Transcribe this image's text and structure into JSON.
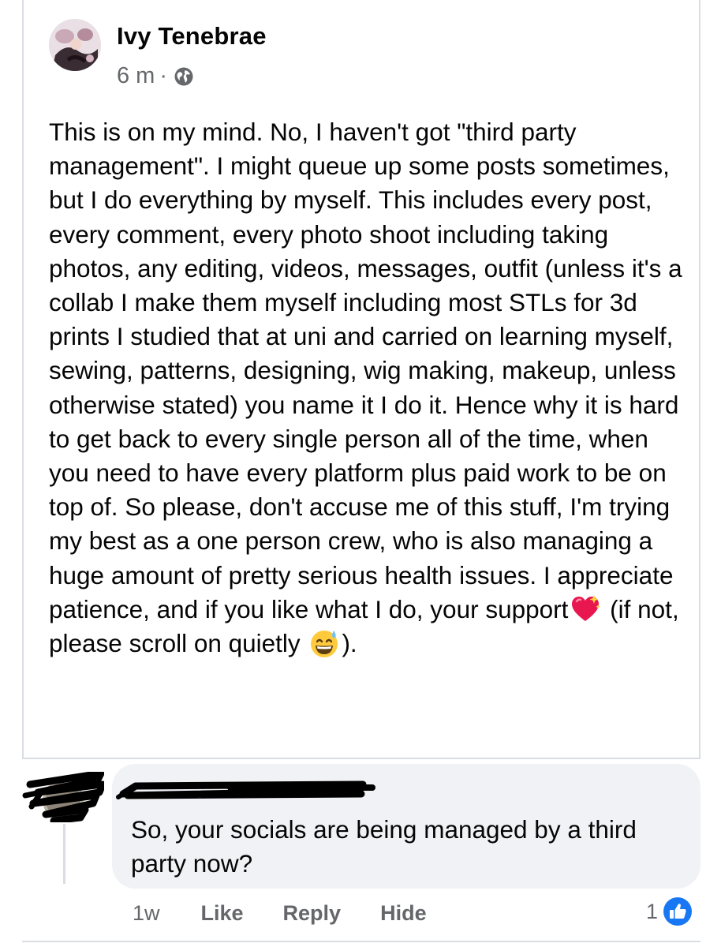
{
  "post": {
    "author": "Ivy Tenebrae",
    "time": "6 m",
    "separator": "·",
    "privacy_icon": "globe-icon",
    "body_main": "This is on my mind. No, I haven't got \"third party management\". I might queue up some posts sometimes, but I do everything by myself. This includes every post, every comment, every photo shoot including taking photos, any editing, videos, messages, outfit (unless it's a collab I make them myself including most STLs for 3d prints I studied that at uni and carried on learning myself, sewing, patterns, designing, wig making, makeup, unless otherwise stated) you name it I do it. Hence why it is hard to get back to every single person all of the time, when you need to have every platform plus paid work to be on top of. So please, don't accuse me of this stuff, I'm trying my best as a one person crew, who is also managing a huge amount of pretty serious health issues. I appreciate patience, and if you like what I do, your support",
    "body_mid": " (if not, please scroll on quietly ",
    "body_end": ").",
    "emoji_1": "sparkling-heart-emoji",
    "emoji_2": "grinning-sweat-emoji"
  },
  "comment": {
    "author_redacted": true,
    "text": "So, your socials are being managed by a third party now?",
    "time": "1w",
    "actions": {
      "like": "Like",
      "reply": "Reply",
      "hide": "Hide"
    },
    "reaction_count": "1",
    "reaction_icon": "like-icon"
  },
  "colors": {
    "meta_gray": "#65676b",
    "bubble_bg": "#f0f2f5",
    "like_blue": "#1877f2",
    "heart_pink": "#e8174f"
  }
}
